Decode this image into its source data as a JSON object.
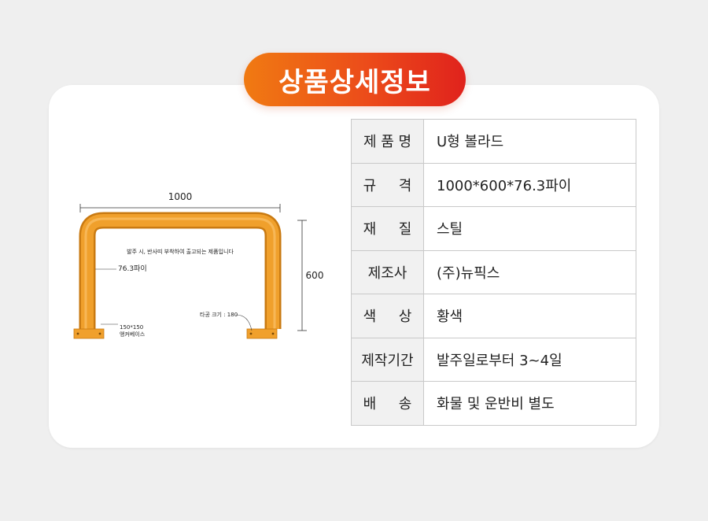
{
  "title": "상품상세정보",
  "drawing": {
    "width_label": "1000",
    "height_label": "600",
    "note": "발주 시, 반사띠 부착하여 출고되는 제품입니다",
    "pipe_label": "76.3파이",
    "base_size": "150*150",
    "base_label": "앵커베이스",
    "hole_label": "타공 크기 : 180"
  },
  "specs": [
    {
      "key": "제 품 명",
      "value": "U형 볼라드"
    },
    {
      "key": "규     격",
      "value": "1000*600*76.3파이"
    },
    {
      "key": "재     질",
      "value": "스틸"
    },
    {
      "key": "제조사",
      "value": "(주)뉴픽스"
    },
    {
      "key": "색     상",
      "value": "황색"
    },
    {
      "key": "제작기간",
      "value": "발주일로부터 3~4일"
    },
    {
      "key": "배     송",
      "value": "화물 및 운반비 별도"
    }
  ],
  "colors": {
    "pipe": "#f0a02c",
    "pipe_dark": "#c97a12",
    "title_start": "#f07a12",
    "title_end": "#e0221c"
  }
}
